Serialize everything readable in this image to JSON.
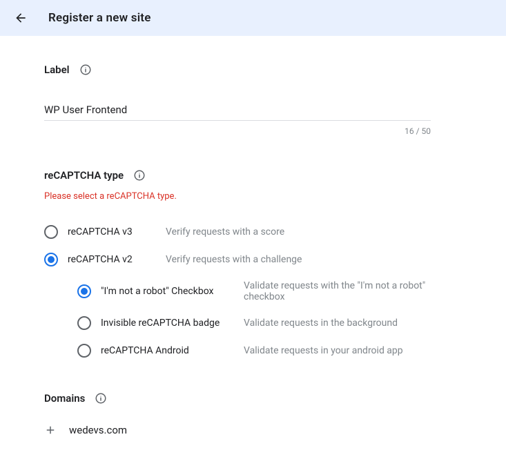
{
  "header": {
    "title": "Register a new site"
  },
  "label": {
    "section_title": "Label",
    "value": "WP User Frontend",
    "char_count": "16 / 50"
  },
  "type": {
    "section_title": "reCAPTCHA type",
    "error": "Please select a reCAPTCHA type.",
    "options": [
      {
        "label": "reCAPTCHA v3",
        "desc": "Verify requests with a score",
        "selected": false
      },
      {
        "label": "reCAPTCHA v2",
        "desc": "Verify requests with a challenge",
        "selected": true
      }
    ],
    "sub_options": [
      {
        "label": "\"I'm not a robot\" Checkbox",
        "desc": "Validate requests with the \"I'm not a robot\" checkbox",
        "selected": true
      },
      {
        "label": "Invisible reCAPTCHA badge",
        "desc": "Validate requests in the background",
        "selected": false
      },
      {
        "label": "reCAPTCHA Android",
        "desc": "Validate requests in your android app",
        "selected": false
      }
    ]
  },
  "domains": {
    "section_title": "Domains",
    "items": [
      "wedevs.com"
    ]
  }
}
